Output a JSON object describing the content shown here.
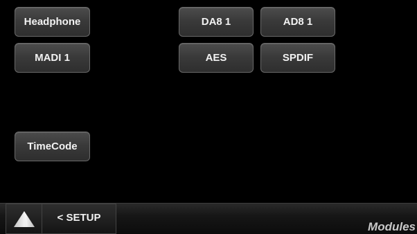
{
  "modules": {
    "headphone": "Headphone",
    "madi_1": "MADI 1",
    "timecode": "TimeCode",
    "da8_1": "DA8 1",
    "ad8_1": "AD8 1",
    "aes": "AES",
    "spdif": "SPDIF"
  },
  "bottom_bar": {
    "home_icon": "triangle-logo-icon",
    "back_label": "< SETUP",
    "page_title": "Modules"
  },
  "colors": {
    "background": "#000000",
    "button_fill": "#3a3a3a",
    "button_border": "#6a6a6a",
    "button_text": "#f2f2f2",
    "title_text": "#c8c8c8"
  }
}
